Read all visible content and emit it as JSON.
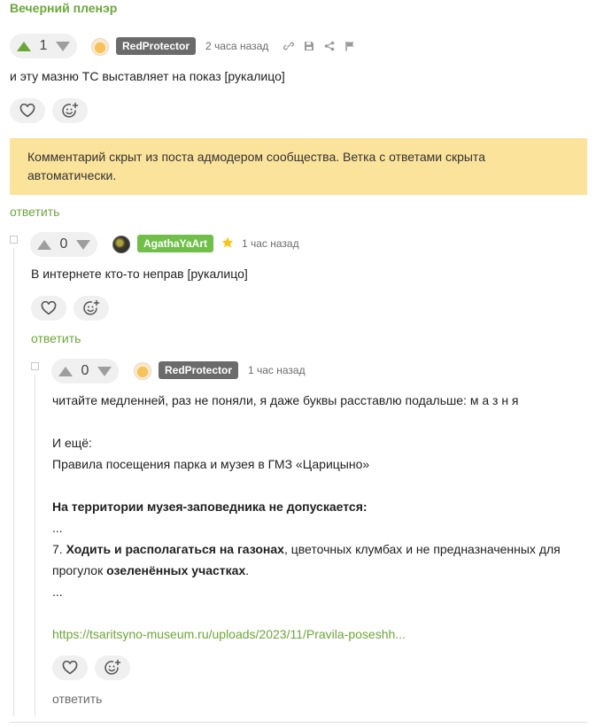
{
  "post": {
    "title": "Вечерний пленэр"
  },
  "comment1": {
    "votes": "1",
    "author": "RedProtector",
    "time": "2 часа назад",
    "text": "и эту мазню ТС выставляет на показ [рукалицо]"
  },
  "notice": {
    "text": "Комментарий скрыт из поста адмодером сообщества. Ветка с ответами скрыта автоматически."
  },
  "reply_label": "ответить",
  "comment2": {
    "votes": "0",
    "author": "AgathaYaArt",
    "time": "1 час назад",
    "text": "В интернете кто-то неправ [рукалицо]"
  },
  "comment3": {
    "votes": "0",
    "author": "RedProtector",
    "time": "1 час назад",
    "line1": "читайте медленней, раз не поняли, я даже буквы расставлю подальше: м а з н я",
    "line2": "И ещё:",
    "line3": "Правила посещения парка и музея в ГМЗ «Царицыно»",
    "line4": "На территории музея-заповедника не допускается:",
    "ellipsis": "...",
    "rule_num": "7. ",
    "rule_bold1": "Ходить и располагаться на газонах",
    "rule_mid": ", цветочных клумбах и не предназначенных для прогулок ",
    "rule_bold2": "озеленённых участках",
    "rule_end": ".",
    "link": "https://tsaritsyno-museum.ru/uploads/2023/11/Pravila-poseshh..."
  },
  "colors": {
    "accent": "#6ca63a",
    "notice_bg": "#fbe39b",
    "badge_author": "#6b6b6b",
    "badge_op": "#6fbf49",
    "star": "#f5c518"
  },
  "icons": [
    "arrow-up-icon",
    "arrow-down-icon",
    "link-icon",
    "save-icon",
    "share-icon",
    "flag-icon",
    "heart-icon",
    "emoji-add-icon",
    "star-icon",
    "collapse-icon"
  ]
}
